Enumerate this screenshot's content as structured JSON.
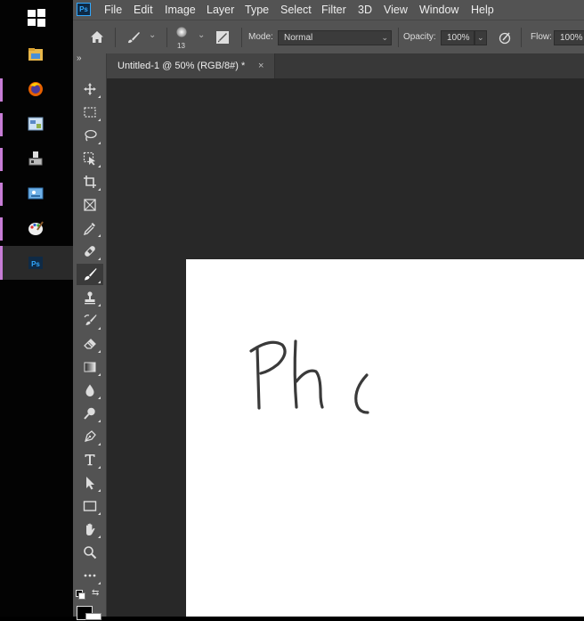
{
  "taskbar": {
    "items": [
      {
        "name": "windows-start"
      },
      {
        "name": "file-explorer"
      },
      {
        "name": "firefox"
      },
      {
        "name": "control-panel"
      },
      {
        "name": "network"
      },
      {
        "name": "photo-viewer"
      },
      {
        "name": "paint"
      },
      {
        "name": "photoshop"
      }
    ]
  },
  "app": {
    "logo": "Ps",
    "menu": [
      "File",
      "Edit",
      "Image",
      "Layer",
      "Type",
      "Select",
      "Filter",
      "3D",
      "View",
      "Window",
      "Help"
    ]
  },
  "options": {
    "brush_size": "13",
    "mode_label": "Mode:",
    "mode_value": "Normal",
    "opacity_label": "Opacity:",
    "opacity_value": "100%",
    "flow_label": "Flow:",
    "flow_value": "100%"
  },
  "tools_collapse": "»",
  "document": {
    "tab_title": "Untitled-1 @ 50% (RGB/8#) *",
    "close_glyph": "×",
    "canvas_text": "Phc"
  },
  "colors": {
    "accent": "#c77dd6",
    "ps_blue": "#31a8ff",
    "panel": "#535353",
    "workspace": "#282828"
  }
}
